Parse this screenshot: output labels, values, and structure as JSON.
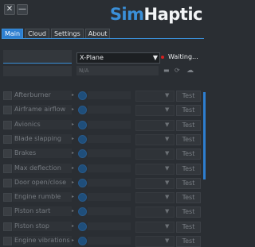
{
  "window": {
    "close_icon": "close-icon",
    "minimize_icon": "minimize-icon",
    "close_glyph": "✕",
    "minimize_glyph": "—"
  },
  "brand": {
    "sim": "Sim",
    "haptic": "Haptic"
  },
  "tabs": [
    "Main",
    "Cloud",
    "Settings",
    "About"
  ],
  "active_tab": "Main",
  "simulator": {
    "selected": "X-Plane",
    "status": "Waiting...",
    "status_color": "#d82020",
    "aircraft_field": "N/A"
  },
  "accent_color": "#2d7ed0",
  "effects": [
    {
      "label": "Afterburner",
      "test_label": "Test"
    },
    {
      "label": "Airframe airflow",
      "test_label": "Test"
    },
    {
      "label": "Avionics",
      "test_label": "Test"
    },
    {
      "label": "Blade slapping",
      "test_label": "Test"
    },
    {
      "label": "Brakes",
      "test_label": "Test"
    },
    {
      "label": "Max deflection",
      "test_label": "Test"
    },
    {
      "label": "Door open/close",
      "test_label": "Test"
    },
    {
      "label": "Engine rumble",
      "test_label": "Test"
    },
    {
      "label": "Piston start",
      "test_label": "Test"
    },
    {
      "label": "Piston stop",
      "test_label": "Test"
    },
    {
      "label": "Engine vibrations",
      "test_label": "Test"
    }
  ]
}
